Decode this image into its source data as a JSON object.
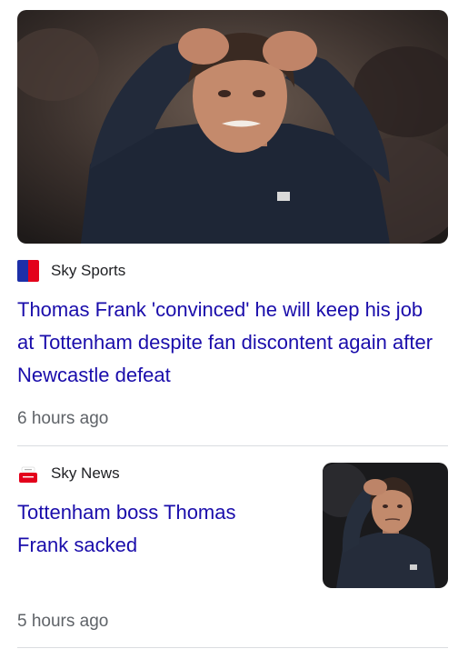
{
  "articles": [
    {
      "source": "Sky Sports",
      "headline": "Thomas Frank 'convinced' he will keep his job at Tottenham despite fan discontent again after Newcastle defeat",
      "time": "6 hours ago",
      "logo_colors": {
        "left": "#1c2fa8",
        "right": "#e3001b"
      }
    },
    {
      "source": "Sky News",
      "headline": "Tottenham boss Thomas Frank sacked",
      "time": "5 hours ago",
      "logo_colors": {
        "top": "#e3001b"
      }
    }
  ]
}
